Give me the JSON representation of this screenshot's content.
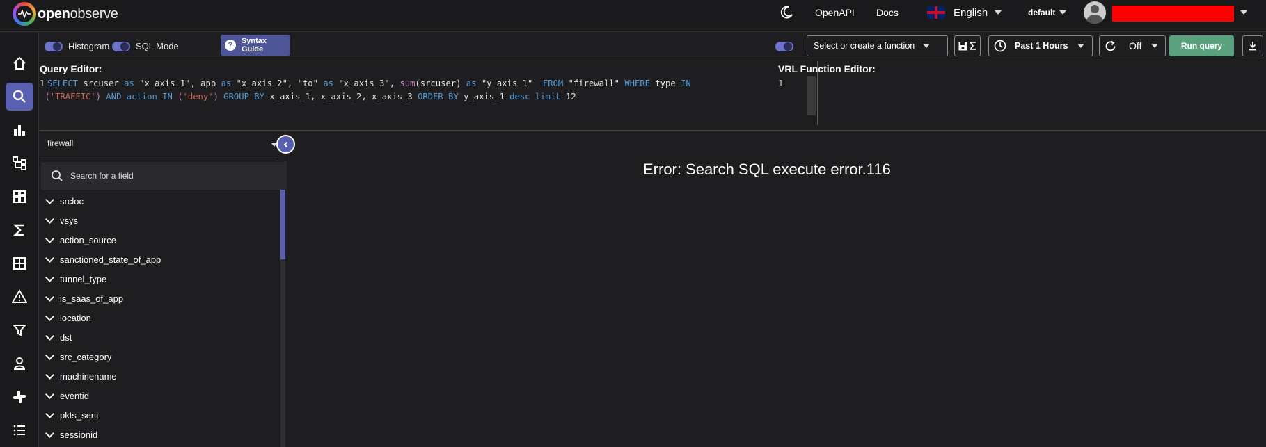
{
  "header": {
    "logo_text_a": "open",
    "logo_text_b": "observe",
    "openapi": "OpenAPI",
    "docs": "Docs",
    "language": "English",
    "org": "default"
  },
  "toolbar": {
    "histogram_label": "Histogram",
    "sql_mode_label": "SQL Mode",
    "syntax_guide_label": "Syntax Guide",
    "function_placeholder": "Select or create a function",
    "time_range": "Past 1 Hours",
    "refresh": "Off",
    "run_query": "Run query"
  },
  "editors": {
    "query_title": "Query Editor:",
    "vrl_title": "VRL Function Editor:",
    "line1_no": "1",
    "vrl_line1_no": "1"
  },
  "fields": {
    "stream": "firewall",
    "search_placeholder": "Search for a field",
    "items": [
      "srcloc",
      "vsys",
      "action_source",
      "sanctioned_state_of_app",
      "tunnel_type",
      "is_saas_of_app",
      "location",
      "dst",
      "src_category",
      "machinename",
      "eventid",
      "pkts_sent",
      "sessionid"
    ]
  },
  "result": {
    "error": "Error: Search SQL execute error.116"
  }
}
